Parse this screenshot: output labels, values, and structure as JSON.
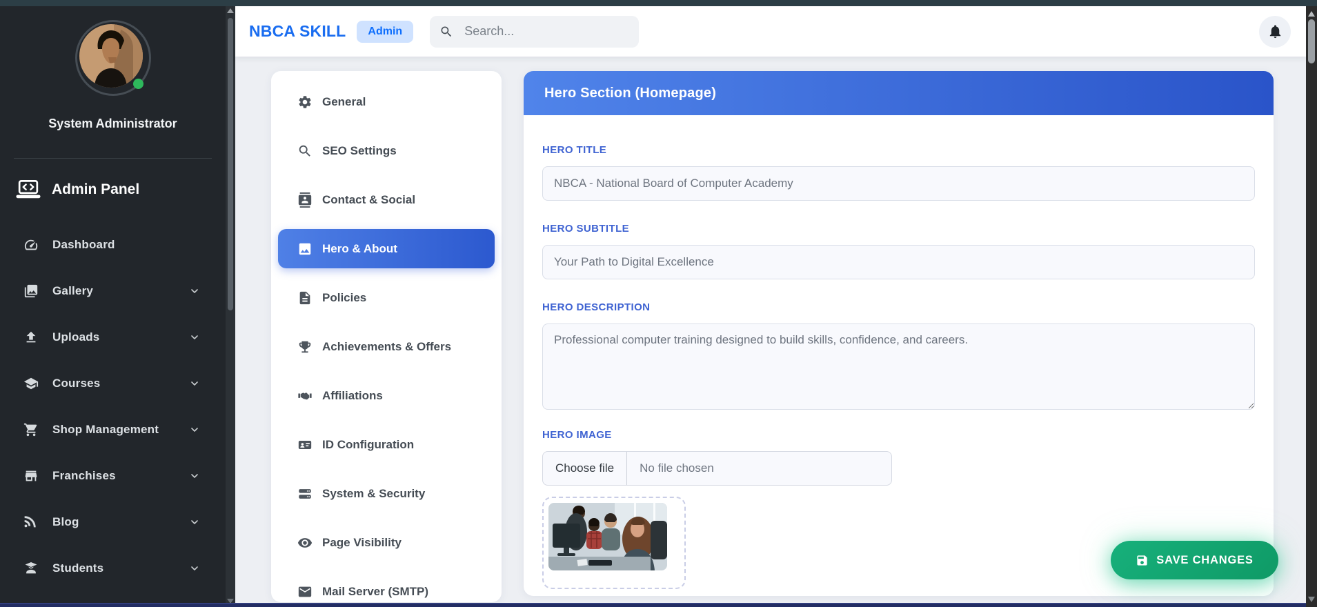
{
  "user": {
    "name": "System Administrator",
    "status": "online"
  },
  "sidebar": {
    "panel_title": "Admin Panel",
    "items": [
      {
        "label": "Dashboard",
        "icon": "dashboard-icon",
        "expandable": false
      },
      {
        "label": "Gallery",
        "icon": "gallery-icon",
        "expandable": true
      },
      {
        "label": "Uploads",
        "icon": "upload-icon",
        "expandable": true
      },
      {
        "label": "Courses",
        "icon": "graduation-cap-icon",
        "expandable": true
      },
      {
        "label": "Shop Management",
        "icon": "cart-icon",
        "expandable": true
      },
      {
        "label": "Franchises",
        "icon": "store-icon",
        "expandable": true
      },
      {
        "label": "Blog",
        "icon": "blog-icon",
        "expandable": true
      },
      {
        "label": "Students",
        "icon": "student-icon",
        "expandable": true
      }
    ]
  },
  "header": {
    "brand": "NBCA SKILL",
    "badge": "Admin",
    "search_placeholder": "Search..."
  },
  "settings_nav": {
    "items": [
      {
        "label": "General",
        "icon": "gear-icon",
        "active": false
      },
      {
        "label": "SEO Settings",
        "icon": "search-icon",
        "active": false
      },
      {
        "label": "Contact & Social",
        "icon": "contact-card-icon",
        "active": false
      },
      {
        "label": "Hero & About",
        "icon": "image-icon",
        "active": true
      },
      {
        "label": "Policies",
        "icon": "document-icon",
        "active": false
      },
      {
        "label": "Achievements & Offers",
        "icon": "trophy-icon",
        "active": false
      },
      {
        "label": "Affiliations",
        "icon": "handshake-icon",
        "active": false
      },
      {
        "label": "ID Configuration",
        "icon": "id-card-icon",
        "active": false
      },
      {
        "label": "System & Security",
        "icon": "server-icon",
        "active": false
      },
      {
        "label": "Page Visibility",
        "icon": "eye-icon",
        "active": false
      },
      {
        "label": "Mail Server (SMTP)",
        "icon": "envelope-icon",
        "active": false
      }
    ]
  },
  "hero_form": {
    "card_title": "Hero Section (Homepage)",
    "title": {
      "label": "HERO TITLE",
      "value": "NBCA - National Board of Computer Academy"
    },
    "subtitle": {
      "label": "HERO SUBTITLE",
      "value": "Your Path to Digital Excellence"
    },
    "description": {
      "label": "HERO DESCRIPTION",
      "value": "Professional computer training designed to build skills, confidence, and careers."
    },
    "image": {
      "label": "HERO IMAGE",
      "choose_button": "Choose file",
      "file_status": "No file chosen"
    },
    "save_button": "SAVE CHANGES"
  },
  "colors": {
    "brand_blue": "#1a6df0",
    "accent_blue": "#2e5ad1",
    "save_green": "#12a571",
    "online_green": "#2eb85c",
    "topbar_teal": "#2c3e46",
    "bottom_strip_navy": "#232d63"
  }
}
